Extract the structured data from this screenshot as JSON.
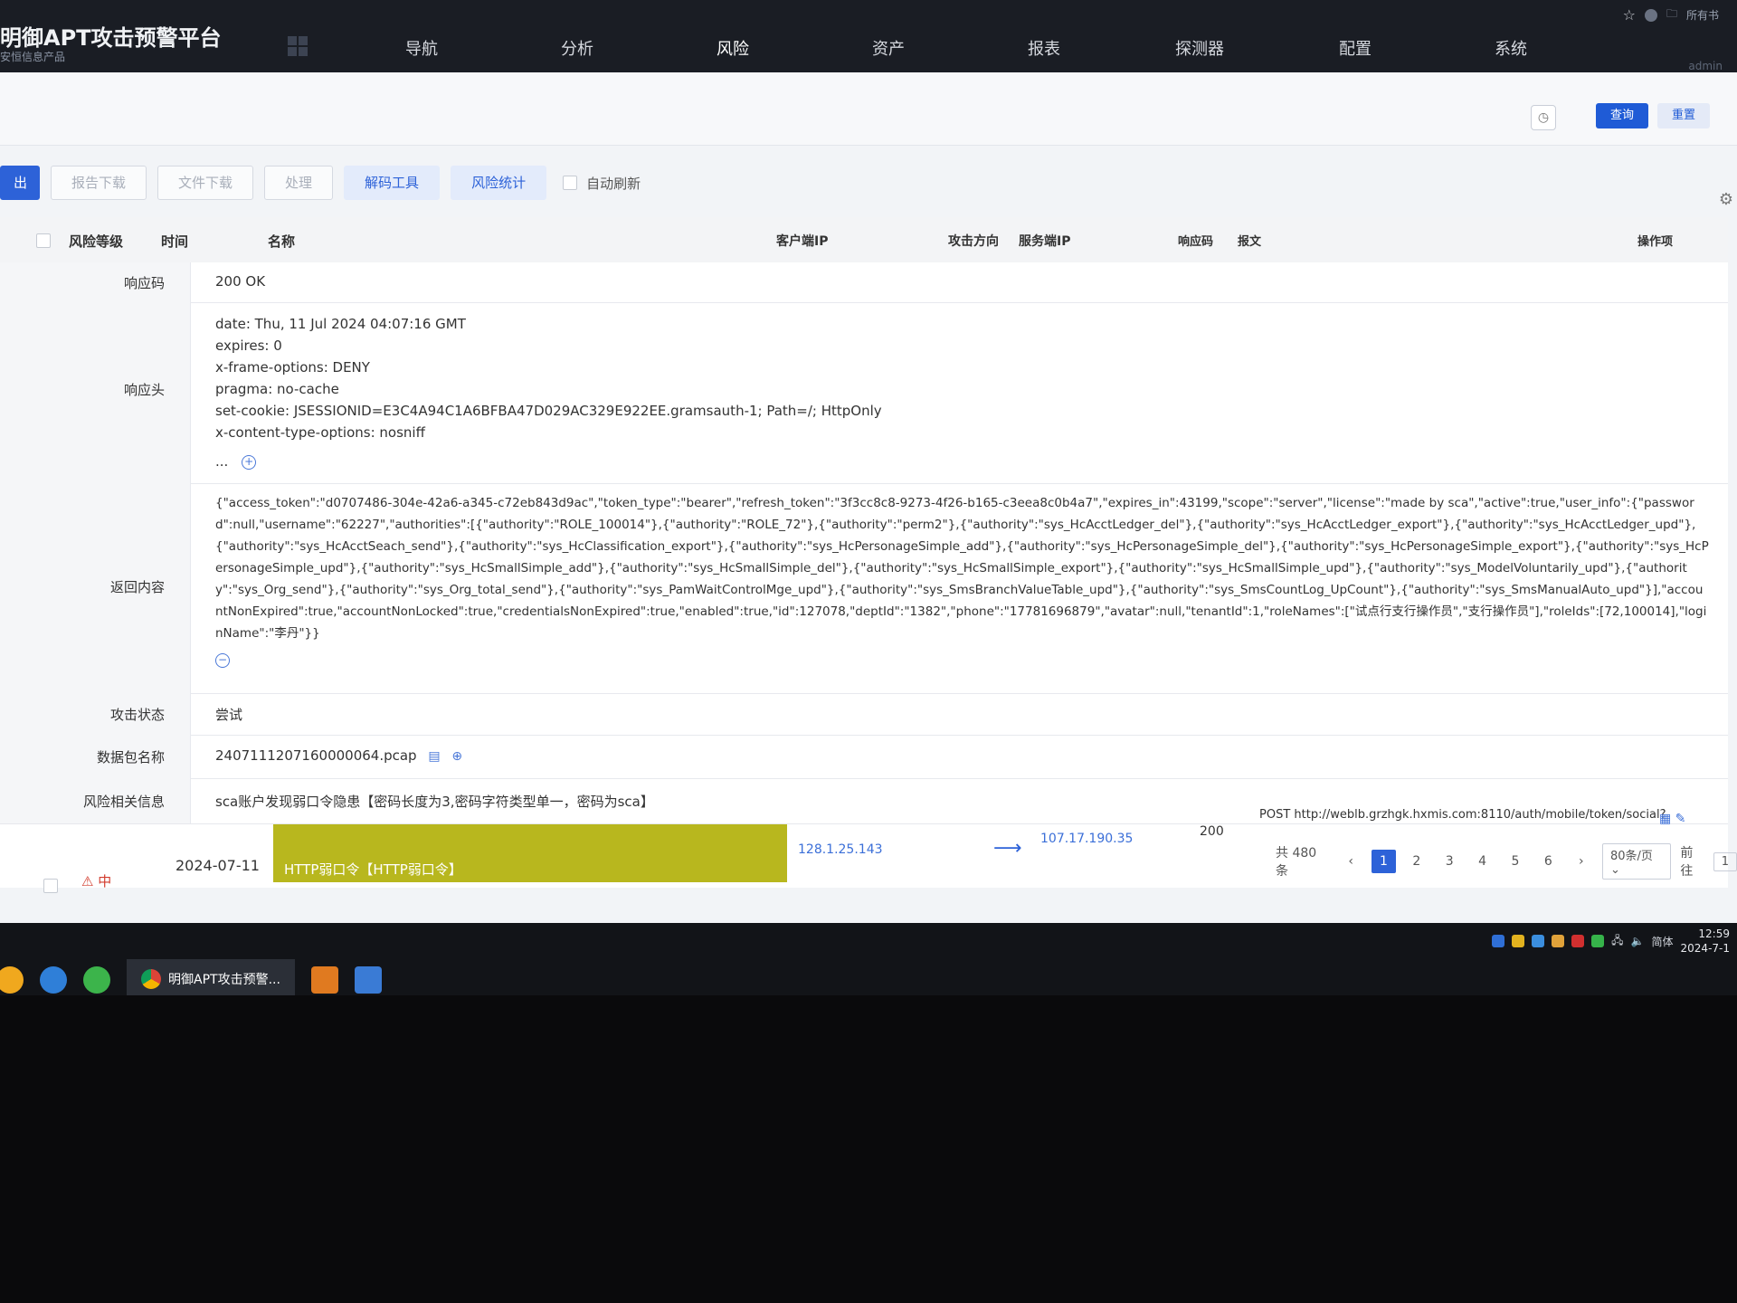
{
  "app": {
    "title": "明御APT攻击预警平台",
    "subtitle": "安恒信息产品"
  },
  "nav": {
    "items": [
      "导航",
      "分析",
      "风险",
      "资产",
      "报表",
      "探测器",
      "配置",
      "系统"
    ],
    "active": "风险"
  },
  "top_right": {
    "bookmark_label": "所有书",
    "menu_hint": "admin"
  },
  "query": {
    "query_label": "查询",
    "reset_label": "重置"
  },
  "toolbar": {
    "export_label": "出",
    "report_download": "报告下载",
    "file_download": "文件下载",
    "handle": "处理",
    "decode_tool": "解码工具",
    "risk_stats": "风险统计",
    "auto_refresh": "自动刷新"
  },
  "table": {
    "headers": {
      "risk_level": "风险等级",
      "time": "时间",
      "name": "名称",
      "client_ip": "客户端IP",
      "direction": "攻击方向",
      "server_ip": "服务端IP",
      "resp_code": "响应码",
      "message": "报文",
      "actions": "操作项"
    }
  },
  "detail": {
    "resp_code_label": "响应码",
    "resp_code_value": "200 OK",
    "resp_header_label": "响应头",
    "resp_headers": [
      "date: Thu, 11 Jul 2024 04:07:16 GMT",
      "expires: 0",
      "x-frame-options: DENY",
      "pragma: no-cache",
      "set-cookie: JSESSIONID=E3C4A94C1A6BFBA47D029AC329E922EE.gramsauth-1; Path=/; HttpOnly",
      "x-content-type-options: nosniff"
    ],
    "ellipsis": "...",
    "return_label": "返回内容",
    "return_content": "{\"access_token\":\"d0707486-304e-42a6-a345-c72eb843d9ac\",\"token_type\":\"bearer\",\"refresh_token\":\"3f3cc8c8-9273-4f26-b165-c3eea8c0b4a7\",\"expires_in\":43199,\"scope\":\"server\",\"license\":\"made by sca\",\"active\":true,\"user_info\":{\"password\":null,\"username\":\"62227\",\"authorities\":[{\"authority\":\"ROLE_100014\"},{\"authority\":\"ROLE_72\"},{\"authority\":\"perm2\"},{\"authority\":\"sys_HcAcctLedger_del\"},{\"authority\":\"sys_HcAcctLedger_export\"},{\"authority\":\"sys_HcAcctLedger_upd\"},{\"authority\":\"sys_HcAcctSeach_send\"},{\"authority\":\"sys_HcClassification_export\"},{\"authority\":\"sys_HcPersonageSimple_add\"},{\"authority\":\"sys_HcPersonageSimple_del\"},{\"authority\":\"sys_HcPersonageSimple_export\"},{\"authority\":\"sys_HcPersonageSimple_upd\"},{\"authority\":\"sys_HcSmallSimple_add\"},{\"authority\":\"sys_HcSmallSimple_del\"},{\"authority\":\"sys_HcSmallSimple_export\"},{\"authority\":\"sys_HcSmallSimple_upd\"},{\"authority\":\"sys_ModelVoluntarily_upd\"},{\"authority\":\"sys_Org_send\"},{\"authority\":\"sys_Org_total_send\"},{\"authority\":\"sys_PamWaitControlMge_upd\"},{\"authority\":\"sys_SmsBranchValueTable_upd\"},{\"authority\":\"sys_SmsCountLog_UpCount\"},{\"authority\":\"sys_SmsManualAuto_upd\"}],\"accountNonExpired\":true,\"accountNonLocked\":true,\"credentialsNonExpired\":true,\"enabled\":true,\"id\":127078,\"deptId\":\"1382\",\"phone\":\"17781696879\",\"avatar\":null,\"tenantId\":1,\"roleNames\":[\"试点行支行操作员\",\"支行操作员\"],\"roleIds\":[72,100014],\"loginName\":\"李丹\"}}",
    "attack_state_label": "攻击状态",
    "attack_state_value": "尝试",
    "pcap_label": "数据包名称",
    "pcap_value": "2407111207160000064.pcap",
    "risk_info_label": "风险相关信息",
    "risk_info_value": "sca账户发现弱口令隐患【密码长度为3,密码字符类型单一，密码为sca】"
  },
  "data_row": {
    "risk_level": "中",
    "date": "2024-07-11",
    "name": "HTTP弱口令【HTTP弱口令】",
    "client_ip": "128.1.25.143",
    "server_ip": "107.17.190.35",
    "resp_code": "200",
    "message": "POST http://weblb.grzhgk.hxmis.com:8110/auth/mobile/token/social?"
  },
  "pagination": {
    "total": "共 480 条",
    "pages": [
      "1",
      "2",
      "3",
      "4",
      "5",
      "6"
    ],
    "active_page": "1",
    "page_size": "80条/页",
    "goto_label": "前往",
    "goto_value": "1"
  },
  "taskbar": {
    "active_task": "明御APT攻击预警...",
    "ime": "简体",
    "time": "12:59",
    "date": "2024-7-1"
  },
  "colors": {
    "topbar": "#1a1d24",
    "primary": "#2d62d8",
    "name_bar": "#b8b71e",
    "risk_mid": "#d23b2c"
  }
}
